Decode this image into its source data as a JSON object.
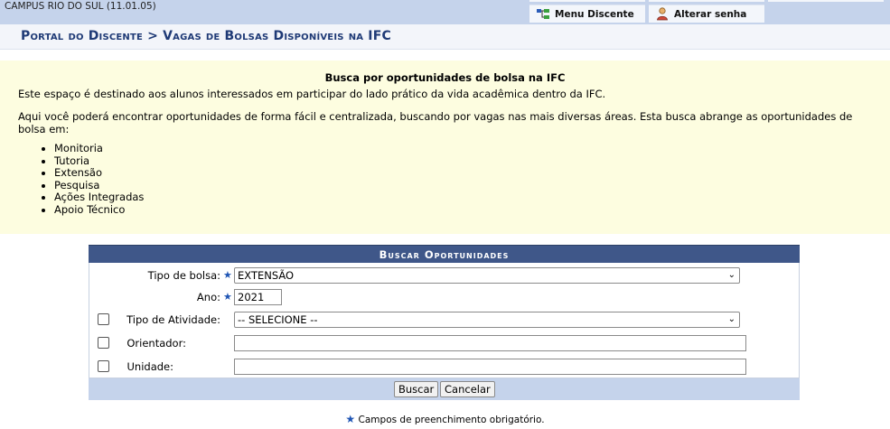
{
  "header": {
    "campus": "CAMPUS RIO DO SUL (11.01.05)",
    "menu_discente": "Menu Discente",
    "alterar_senha": "Alterar senha",
    "menu_icon": "menu-tree-icon",
    "senha_icon": "user-key-icon"
  },
  "breadcrumb": {
    "text": "Portal do Discente > Vagas de Bolsas Disponíveis na IFC"
  },
  "intro": {
    "title": "Busca por oportunidades de bolsa na IFC",
    "p1": "Este espaço é destinado aos alunos interessados em participar do lado prático da vida acadêmica dentro da IFC.",
    "p2": "Aqui você poderá encontrar oportunidades de forma fácil e centralizada, buscando por vagas nas mais diversas áreas. Esta busca abrange as oportunidades de bolsa em:",
    "items": [
      "Monitoria",
      "Tutoria",
      "Extensão",
      "Pesquisa",
      "Ações Integradas",
      "Apoio Técnico"
    ]
  },
  "form": {
    "title": "Buscar Oportunidades",
    "tipo_bolsa_label": "Tipo de bolsa:",
    "tipo_bolsa_value": "EXTENSÃO",
    "ano_label": "Ano:",
    "ano_value": "2021",
    "tipo_atividade_label": "Tipo de Atividade:",
    "tipo_atividade_value": "-- SELECIONE --",
    "orientador_label": "Orientador:",
    "orientador_value": "",
    "unidade_label": "Unidade:",
    "unidade_value": "",
    "buscar": "Buscar",
    "cancelar": "Cancelar",
    "required_marker": "★"
  },
  "footer": {
    "required_note": "Campos de preenchimento obrigatório."
  },
  "colors": {
    "topbar": "#c5d3eb",
    "form_header": "#3f5789",
    "breadcrumb": "#1f3a76",
    "intro_bg": "#fdfde0",
    "required": "#1f55b4"
  }
}
